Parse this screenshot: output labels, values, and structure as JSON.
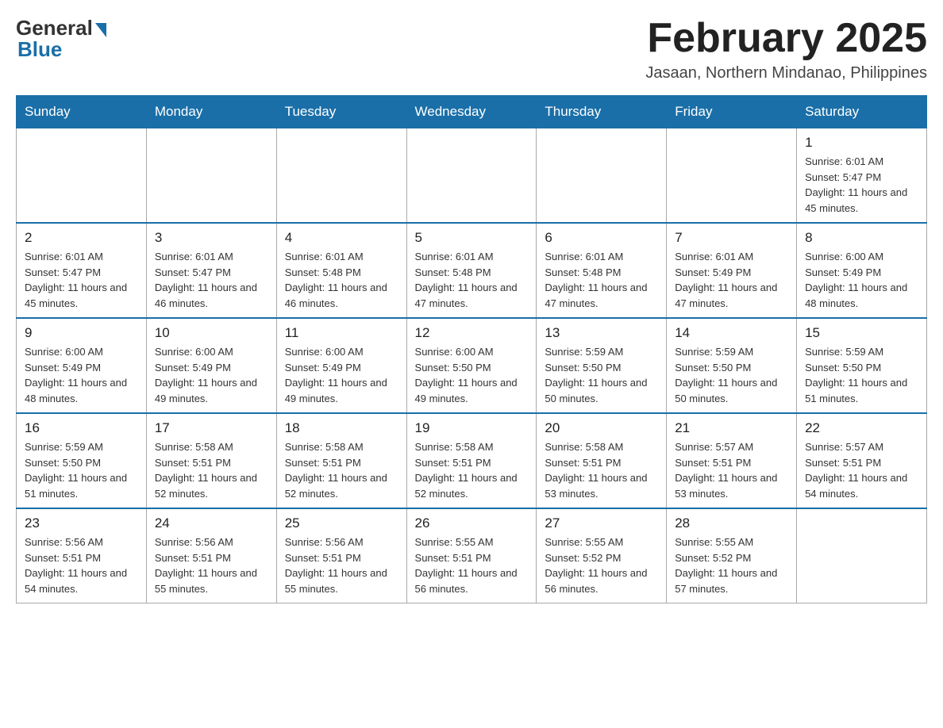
{
  "header": {
    "logo_general": "General",
    "logo_blue": "Blue",
    "title": "February 2025",
    "location": "Jasaan, Northern Mindanao, Philippines"
  },
  "days_of_week": [
    "Sunday",
    "Monday",
    "Tuesday",
    "Wednesday",
    "Thursday",
    "Friday",
    "Saturday"
  ],
  "weeks": [
    [
      {
        "day": "",
        "sunrise": "",
        "sunset": "",
        "daylight": ""
      },
      {
        "day": "",
        "sunrise": "",
        "sunset": "",
        "daylight": ""
      },
      {
        "day": "",
        "sunrise": "",
        "sunset": "",
        "daylight": ""
      },
      {
        "day": "",
        "sunrise": "",
        "sunset": "",
        "daylight": ""
      },
      {
        "day": "",
        "sunrise": "",
        "sunset": "",
        "daylight": ""
      },
      {
        "day": "",
        "sunrise": "",
        "sunset": "",
        "daylight": ""
      },
      {
        "day": "1",
        "sunrise": "Sunrise: 6:01 AM",
        "sunset": "Sunset: 5:47 PM",
        "daylight": "Daylight: 11 hours and 45 minutes."
      }
    ],
    [
      {
        "day": "2",
        "sunrise": "Sunrise: 6:01 AM",
        "sunset": "Sunset: 5:47 PM",
        "daylight": "Daylight: 11 hours and 45 minutes."
      },
      {
        "day": "3",
        "sunrise": "Sunrise: 6:01 AM",
        "sunset": "Sunset: 5:47 PM",
        "daylight": "Daylight: 11 hours and 46 minutes."
      },
      {
        "day": "4",
        "sunrise": "Sunrise: 6:01 AM",
        "sunset": "Sunset: 5:48 PM",
        "daylight": "Daylight: 11 hours and 46 minutes."
      },
      {
        "day": "5",
        "sunrise": "Sunrise: 6:01 AM",
        "sunset": "Sunset: 5:48 PM",
        "daylight": "Daylight: 11 hours and 47 minutes."
      },
      {
        "day": "6",
        "sunrise": "Sunrise: 6:01 AM",
        "sunset": "Sunset: 5:48 PM",
        "daylight": "Daylight: 11 hours and 47 minutes."
      },
      {
        "day": "7",
        "sunrise": "Sunrise: 6:01 AM",
        "sunset": "Sunset: 5:49 PM",
        "daylight": "Daylight: 11 hours and 47 minutes."
      },
      {
        "day": "8",
        "sunrise": "Sunrise: 6:00 AM",
        "sunset": "Sunset: 5:49 PM",
        "daylight": "Daylight: 11 hours and 48 minutes."
      }
    ],
    [
      {
        "day": "9",
        "sunrise": "Sunrise: 6:00 AM",
        "sunset": "Sunset: 5:49 PM",
        "daylight": "Daylight: 11 hours and 48 minutes."
      },
      {
        "day": "10",
        "sunrise": "Sunrise: 6:00 AM",
        "sunset": "Sunset: 5:49 PM",
        "daylight": "Daylight: 11 hours and 49 minutes."
      },
      {
        "day": "11",
        "sunrise": "Sunrise: 6:00 AM",
        "sunset": "Sunset: 5:49 PM",
        "daylight": "Daylight: 11 hours and 49 minutes."
      },
      {
        "day": "12",
        "sunrise": "Sunrise: 6:00 AM",
        "sunset": "Sunset: 5:50 PM",
        "daylight": "Daylight: 11 hours and 49 minutes."
      },
      {
        "day": "13",
        "sunrise": "Sunrise: 5:59 AM",
        "sunset": "Sunset: 5:50 PM",
        "daylight": "Daylight: 11 hours and 50 minutes."
      },
      {
        "day": "14",
        "sunrise": "Sunrise: 5:59 AM",
        "sunset": "Sunset: 5:50 PM",
        "daylight": "Daylight: 11 hours and 50 minutes."
      },
      {
        "day": "15",
        "sunrise": "Sunrise: 5:59 AM",
        "sunset": "Sunset: 5:50 PM",
        "daylight": "Daylight: 11 hours and 51 minutes."
      }
    ],
    [
      {
        "day": "16",
        "sunrise": "Sunrise: 5:59 AM",
        "sunset": "Sunset: 5:50 PM",
        "daylight": "Daylight: 11 hours and 51 minutes."
      },
      {
        "day": "17",
        "sunrise": "Sunrise: 5:58 AM",
        "sunset": "Sunset: 5:51 PM",
        "daylight": "Daylight: 11 hours and 52 minutes."
      },
      {
        "day": "18",
        "sunrise": "Sunrise: 5:58 AM",
        "sunset": "Sunset: 5:51 PM",
        "daylight": "Daylight: 11 hours and 52 minutes."
      },
      {
        "day": "19",
        "sunrise": "Sunrise: 5:58 AM",
        "sunset": "Sunset: 5:51 PM",
        "daylight": "Daylight: 11 hours and 52 minutes."
      },
      {
        "day": "20",
        "sunrise": "Sunrise: 5:58 AM",
        "sunset": "Sunset: 5:51 PM",
        "daylight": "Daylight: 11 hours and 53 minutes."
      },
      {
        "day": "21",
        "sunrise": "Sunrise: 5:57 AM",
        "sunset": "Sunset: 5:51 PM",
        "daylight": "Daylight: 11 hours and 53 minutes."
      },
      {
        "day": "22",
        "sunrise": "Sunrise: 5:57 AM",
        "sunset": "Sunset: 5:51 PM",
        "daylight": "Daylight: 11 hours and 54 minutes."
      }
    ],
    [
      {
        "day": "23",
        "sunrise": "Sunrise: 5:56 AM",
        "sunset": "Sunset: 5:51 PM",
        "daylight": "Daylight: 11 hours and 54 minutes."
      },
      {
        "day": "24",
        "sunrise": "Sunrise: 5:56 AM",
        "sunset": "Sunset: 5:51 PM",
        "daylight": "Daylight: 11 hours and 55 minutes."
      },
      {
        "day": "25",
        "sunrise": "Sunrise: 5:56 AM",
        "sunset": "Sunset: 5:51 PM",
        "daylight": "Daylight: 11 hours and 55 minutes."
      },
      {
        "day": "26",
        "sunrise": "Sunrise: 5:55 AM",
        "sunset": "Sunset: 5:51 PM",
        "daylight": "Daylight: 11 hours and 56 minutes."
      },
      {
        "day": "27",
        "sunrise": "Sunrise: 5:55 AM",
        "sunset": "Sunset: 5:52 PM",
        "daylight": "Daylight: 11 hours and 56 minutes."
      },
      {
        "day": "28",
        "sunrise": "Sunrise: 5:55 AM",
        "sunset": "Sunset: 5:52 PM",
        "daylight": "Daylight: 11 hours and 57 minutes."
      },
      {
        "day": "",
        "sunrise": "",
        "sunset": "",
        "daylight": ""
      }
    ]
  ]
}
